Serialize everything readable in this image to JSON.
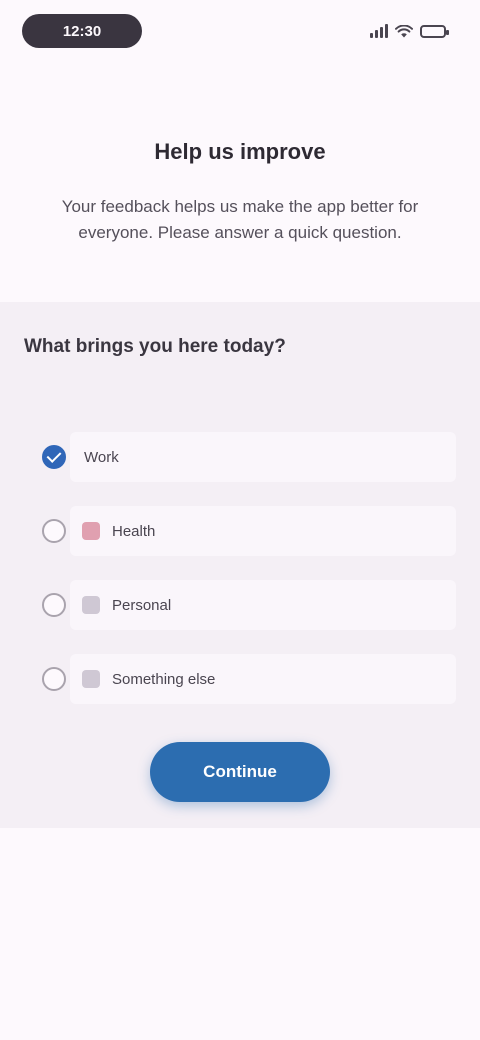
{
  "status_bar": {
    "time": "12:30",
    "icons": [
      "signal-icon",
      "wifi-icon",
      "battery-icon"
    ]
  },
  "header": {
    "title": "Help us improve",
    "description": "Your feedback helps us make the app better for everyone. Please answer a quick question."
  },
  "survey": {
    "question": "What brings you here today?",
    "options": [
      {
        "label": "Work",
        "selected": true,
        "icon": null,
        "icon_color": null
      },
      {
        "label": "Health",
        "selected": false,
        "icon": "heart-icon",
        "icon_color": "#e0a0b0"
      },
      {
        "label": "Personal",
        "selected": false,
        "icon": "person-icon",
        "icon_color": "#cfc8d4"
      },
      {
        "label": "Something else",
        "selected": false,
        "icon": "dots-icon",
        "icon_color": "#cfc8d4"
      }
    ]
  },
  "continue_label": "Continue",
  "colors": {
    "accent": "#2c6db0",
    "background": "#fdf9fd",
    "card": "#f4eff5"
  }
}
